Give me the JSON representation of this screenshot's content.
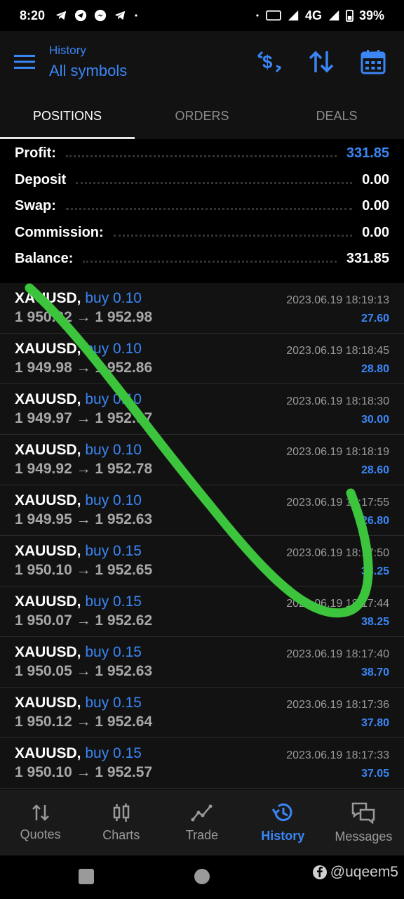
{
  "status": {
    "time": "8:20",
    "network": "4G",
    "battery": "39%"
  },
  "header": {
    "subtitle": "History",
    "title": "All symbols"
  },
  "tabs": [
    {
      "label": "POSITIONS"
    },
    {
      "label": "ORDERS"
    },
    {
      "label": "DEALS"
    }
  ],
  "summary": [
    {
      "label": "Profit:",
      "value": "331.85"
    },
    {
      "label": "Deposit",
      "value": "0.00"
    },
    {
      "label": "Swap:",
      "value": "0.00"
    },
    {
      "label": "Commission:",
      "value": "0.00"
    },
    {
      "label": "Balance:",
      "value": "331.85"
    }
  ],
  "deals": [
    {
      "symbol": "XAUUSD,",
      "type": "buy 0.10",
      "prices": "1 950.32 → 1 952.98",
      "time": "2023.06.19 18:19:13",
      "profit": "27.60"
    },
    {
      "symbol": "XAUUSD,",
      "type": "buy 0.10",
      "prices": "1 949.98 → 1 952.86",
      "time": "2023.06.19 18:18:45",
      "profit": "28.80"
    },
    {
      "symbol": "XAUUSD,",
      "type": "buy 0.10",
      "prices": "1 949.97 → 1 952.97",
      "time": "2023.06.19 18:18:30",
      "profit": "30.00"
    },
    {
      "symbol": "XAUUSD,",
      "type": "buy 0.10",
      "prices": "1 949.92 → 1 952.78",
      "time": "2023.06.19 18:18:19",
      "profit": "28.60"
    },
    {
      "symbol": "XAUUSD,",
      "type": "buy 0.10",
      "prices": "1 949.95 → 1 952.63",
      "time": "2023.06.19 18:17:55",
      "profit": "26.80"
    },
    {
      "symbol": "XAUUSD,",
      "type": "buy 0.15",
      "prices": "1 950.10 → 1 952.65",
      "time": "2023.06.19 18:17:50",
      "profit": "38.25"
    },
    {
      "symbol": "XAUUSD,",
      "type": "buy 0.15",
      "prices": "1 950.07 → 1 952.62",
      "time": "2023.06.19 18:17:44",
      "profit": "38.25"
    },
    {
      "symbol": "XAUUSD,",
      "type": "buy 0.15",
      "prices": "1 950.05 → 1 952.63",
      "time": "2023.06.19 18:17:40",
      "profit": "38.70"
    },
    {
      "symbol": "XAUUSD,",
      "type": "buy 0.15",
      "prices": "1 950.12 → 1 952.64",
      "time": "2023.06.19 18:17:36",
      "profit": "37.80"
    },
    {
      "symbol": "XAUUSD,",
      "type": "buy 0.15",
      "prices": "1 950.10 → 1 952.57",
      "time": "2023.06.19 18:17:33",
      "profit": "37.05"
    }
  ],
  "nav": [
    {
      "label": "Quotes",
      "icon": "quotes-icon"
    },
    {
      "label": "Charts",
      "icon": "charts-icon"
    },
    {
      "label": "Trade",
      "icon": "trade-icon"
    },
    {
      "label": "History",
      "icon": "history-icon"
    },
    {
      "label": "Messages",
      "icon": "messages-icon"
    }
  ],
  "watermark": "@uqeem5",
  "colors": {
    "accent": "#3a86f5",
    "annotation_stroke": "#3cc43c"
  }
}
